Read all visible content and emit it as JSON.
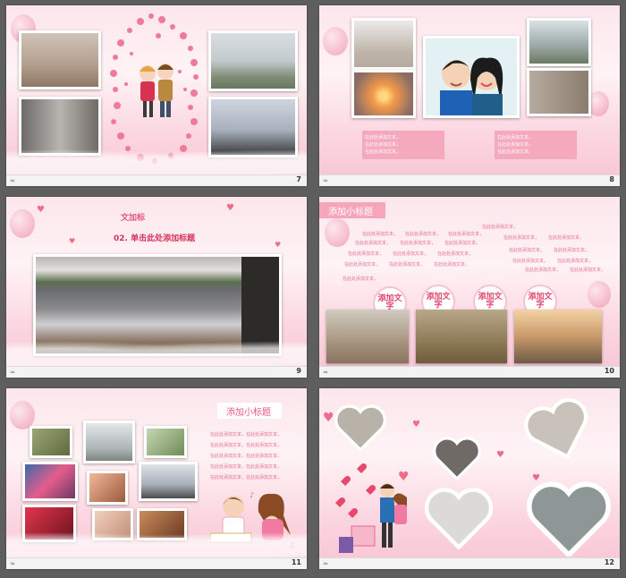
{
  "slides": [
    {
      "number": "7"
    },
    {
      "number": "8",
      "text_lines": [
        "在此处添加文本，",
        "在此处添加文本，",
        "在此处添加文本。"
      ]
    },
    {
      "number": "9",
      "ribbon": "文加标",
      "title": "02. 单击此处添加标题"
    },
    {
      "number": "10",
      "subtitle": "添加小标题",
      "bubbles": [
        "添加文字",
        "添加文字",
        "添加文字",
        "添加文字"
      ],
      "text_lines": [
        "在此处添加文本，",
        "在此处添加文本，",
        "在此处添加文本，",
        "在此处添加文本，",
        "在此处添加文本，",
        "在此处添加文本，"
      ]
    },
    {
      "number": "11",
      "subtitle": "添加小标题",
      "text_lines": [
        "在此处添加文本，在此处添加文本，",
        "在此处添加文本，在此处添加文本，",
        "在此处添加文本，在此处添加文本，",
        "在此处添加文本，在此处添加文本，",
        "在此处添加文本，在此处添加文本，"
      ]
    },
    {
      "number": "12"
    }
  ],
  "footer_icon": "≈",
  "colors": {
    "accent": "#e8577e",
    "frame": "#5e5e5e"
  }
}
